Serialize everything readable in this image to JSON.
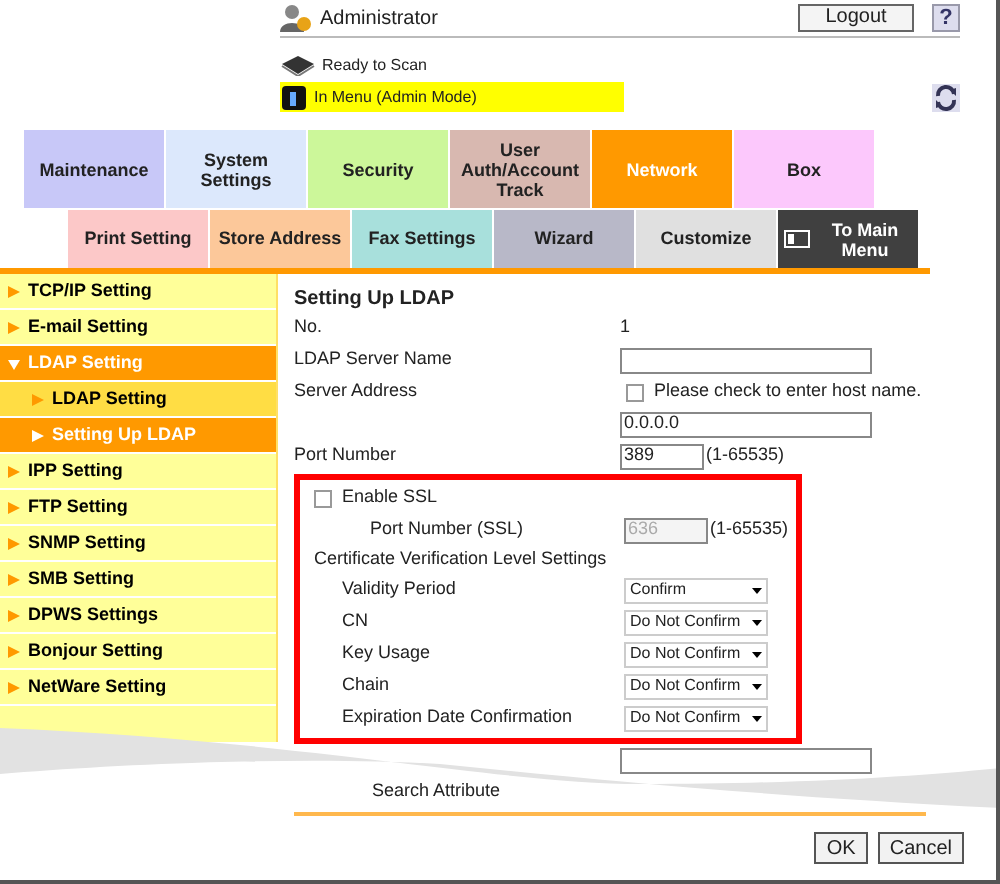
{
  "header": {
    "user": "Administrator",
    "logout": "Logout",
    "help": "?",
    "status": "Ready to Scan",
    "mode": "In Menu (Admin Mode)"
  },
  "nav_tabs": [
    {
      "label": "Maintenance",
      "color": "#c8c8f8",
      "selected": false
    },
    {
      "label": "System Settings",
      "color": "#dce8fc",
      "selected": false
    },
    {
      "label": "Security",
      "color": "#ccf79a",
      "selected": false
    },
    {
      "label": "User Auth/Account Track",
      "color": "#d8b8b0",
      "selected": false
    },
    {
      "label": "Network",
      "color": "#ff9900",
      "selected": true
    },
    {
      "label": "Box",
      "color": "#fcc8fc",
      "selected": false
    }
  ],
  "sub_tabs": [
    {
      "label": "Print Setting",
      "color": "#fcc8c8",
      "kind": "tab"
    },
    {
      "label": "Store Address",
      "color": "#fcc89a",
      "kind": "tab"
    },
    {
      "label": "Fax Settings",
      "color": "#a8e0dc",
      "kind": "tab"
    },
    {
      "label": "Wizard",
      "color": "#b8b8c8",
      "kind": "tab"
    },
    {
      "label": "Customize",
      "color": "#e0e0e0",
      "kind": "tab"
    },
    {
      "label": "To Main Menu",
      "color": "#404040",
      "kind": "main_menu"
    }
  ],
  "sidebar": {
    "items": [
      {
        "label": "TCP/IP Setting",
        "selected": false
      },
      {
        "label": "E-mail Setting",
        "selected": false
      },
      {
        "label": "LDAP Setting",
        "expanded": true,
        "children": [
          {
            "label": "LDAP Setting",
            "selected": false
          },
          {
            "label": "Setting Up LDAP",
            "selected": true
          }
        ]
      },
      {
        "label": "IPP Setting",
        "selected": false
      },
      {
        "label": "FTP Setting",
        "selected": false
      },
      {
        "label": "SNMP Setting",
        "selected": false
      },
      {
        "label": "SMB Setting",
        "selected": false
      },
      {
        "label": "DPWS Settings",
        "selected": false
      },
      {
        "label": "Bonjour Setting",
        "selected": false
      },
      {
        "label": "NetWare Setting",
        "selected": false
      }
    ]
  },
  "form": {
    "title": "Setting Up LDAP",
    "rows": [
      {
        "kind": "value",
        "label": "No.",
        "value": "1"
      },
      {
        "kind": "input",
        "label": "LDAP Server Name"
      },
      {
        "kind": "checkbox",
        "label": "Server Address",
        "note": "Please check to enter host name.",
        "checked": false
      },
      {
        "kind": "input",
        "value": "0.0.0.0"
      },
      {
        "kind": "port",
        "label": "Port Number",
        "value": "389",
        "range": "(1-65535)"
      }
    ],
    "ssl": {
      "enable": {
        "label": "Enable SSL",
        "checked": false
      },
      "port": {
        "label": "Port Number (SSL)",
        "value": "636",
        "range": "(1-65535)",
        "disabled": true
      },
      "cert_heading": "Certificate Verification Level Settings",
      "cert_rows": [
        {
          "label": "Validity Period",
          "value": "Confirm"
        },
        {
          "label": "CN",
          "value": "Do Not Confirm"
        },
        {
          "label": "Key Usage",
          "value": "Do Not Confirm"
        },
        {
          "label": "Chain",
          "value": "Do Not Confirm"
        },
        {
          "label": "Expiration Date Confirmation",
          "value": "Do Not Confirm"
        }
      ]
    },
    "after_rows": [
      {
        "kind": "input"
      },
      {
        "kind": "label",
        "label": "Search Attribute"
      }
    ]
  },
  "buttons": [
    "OK",
    "Cancel"
  ]
}
